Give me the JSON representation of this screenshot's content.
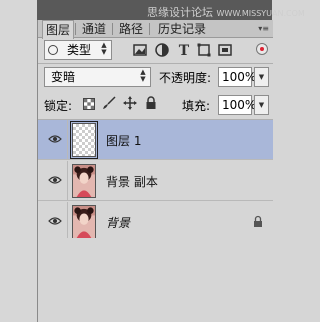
{
  "watermark": {
    "text": "思缘设计论坛",
    "url": "WWW.MISSYUAN.COM"
  },
  "tabs": [
    {
      "label": "图层",
      "active": true
    },
    {
      "label": "通道",
      "active": false
    },
    {
      "label": "路径",
      "active": false
    },
    {
      "label": "历史记录",
      "active": false
    }
  ],
  "filter": {
    "kind_label": "类型",
    "icons": [
      "image-filter-icon",
      "adjustment-filter-icon",
      "text-filter-icon",
      "shape-filter-icon",
      "smart-object-filter-icon"
    ]
  },
  "blend": {
    "mode": "变暗",
    "opacity_label": "不透明度:",
    "opacity_value": "100%"
  },
  "lock": {
    "label": "锁定:",
    "fill_label": "填充:",
    "fill_value": "100%"
  },
  "layers": [
    {
      "name": "图层 1",
      "selected": true,
      "thumb": "transparent",
      "italic": false,
      "locked": false
    },
    {
      "name": "背景 副本",
      "selected": false,
      "thumb": "photo",
      "italic": false,
      "locked": false
    },
    {
      "name": "背景",
      "selected": false,
      "thumb": "photo",
      "italic": true,
      "locked": true
    }
  ],
  "colors": {
    "selected_row": "#a9b7d9",
    "panel_bg": "#d6d6d6",
    "header_bg": "#595959"
  }
}
